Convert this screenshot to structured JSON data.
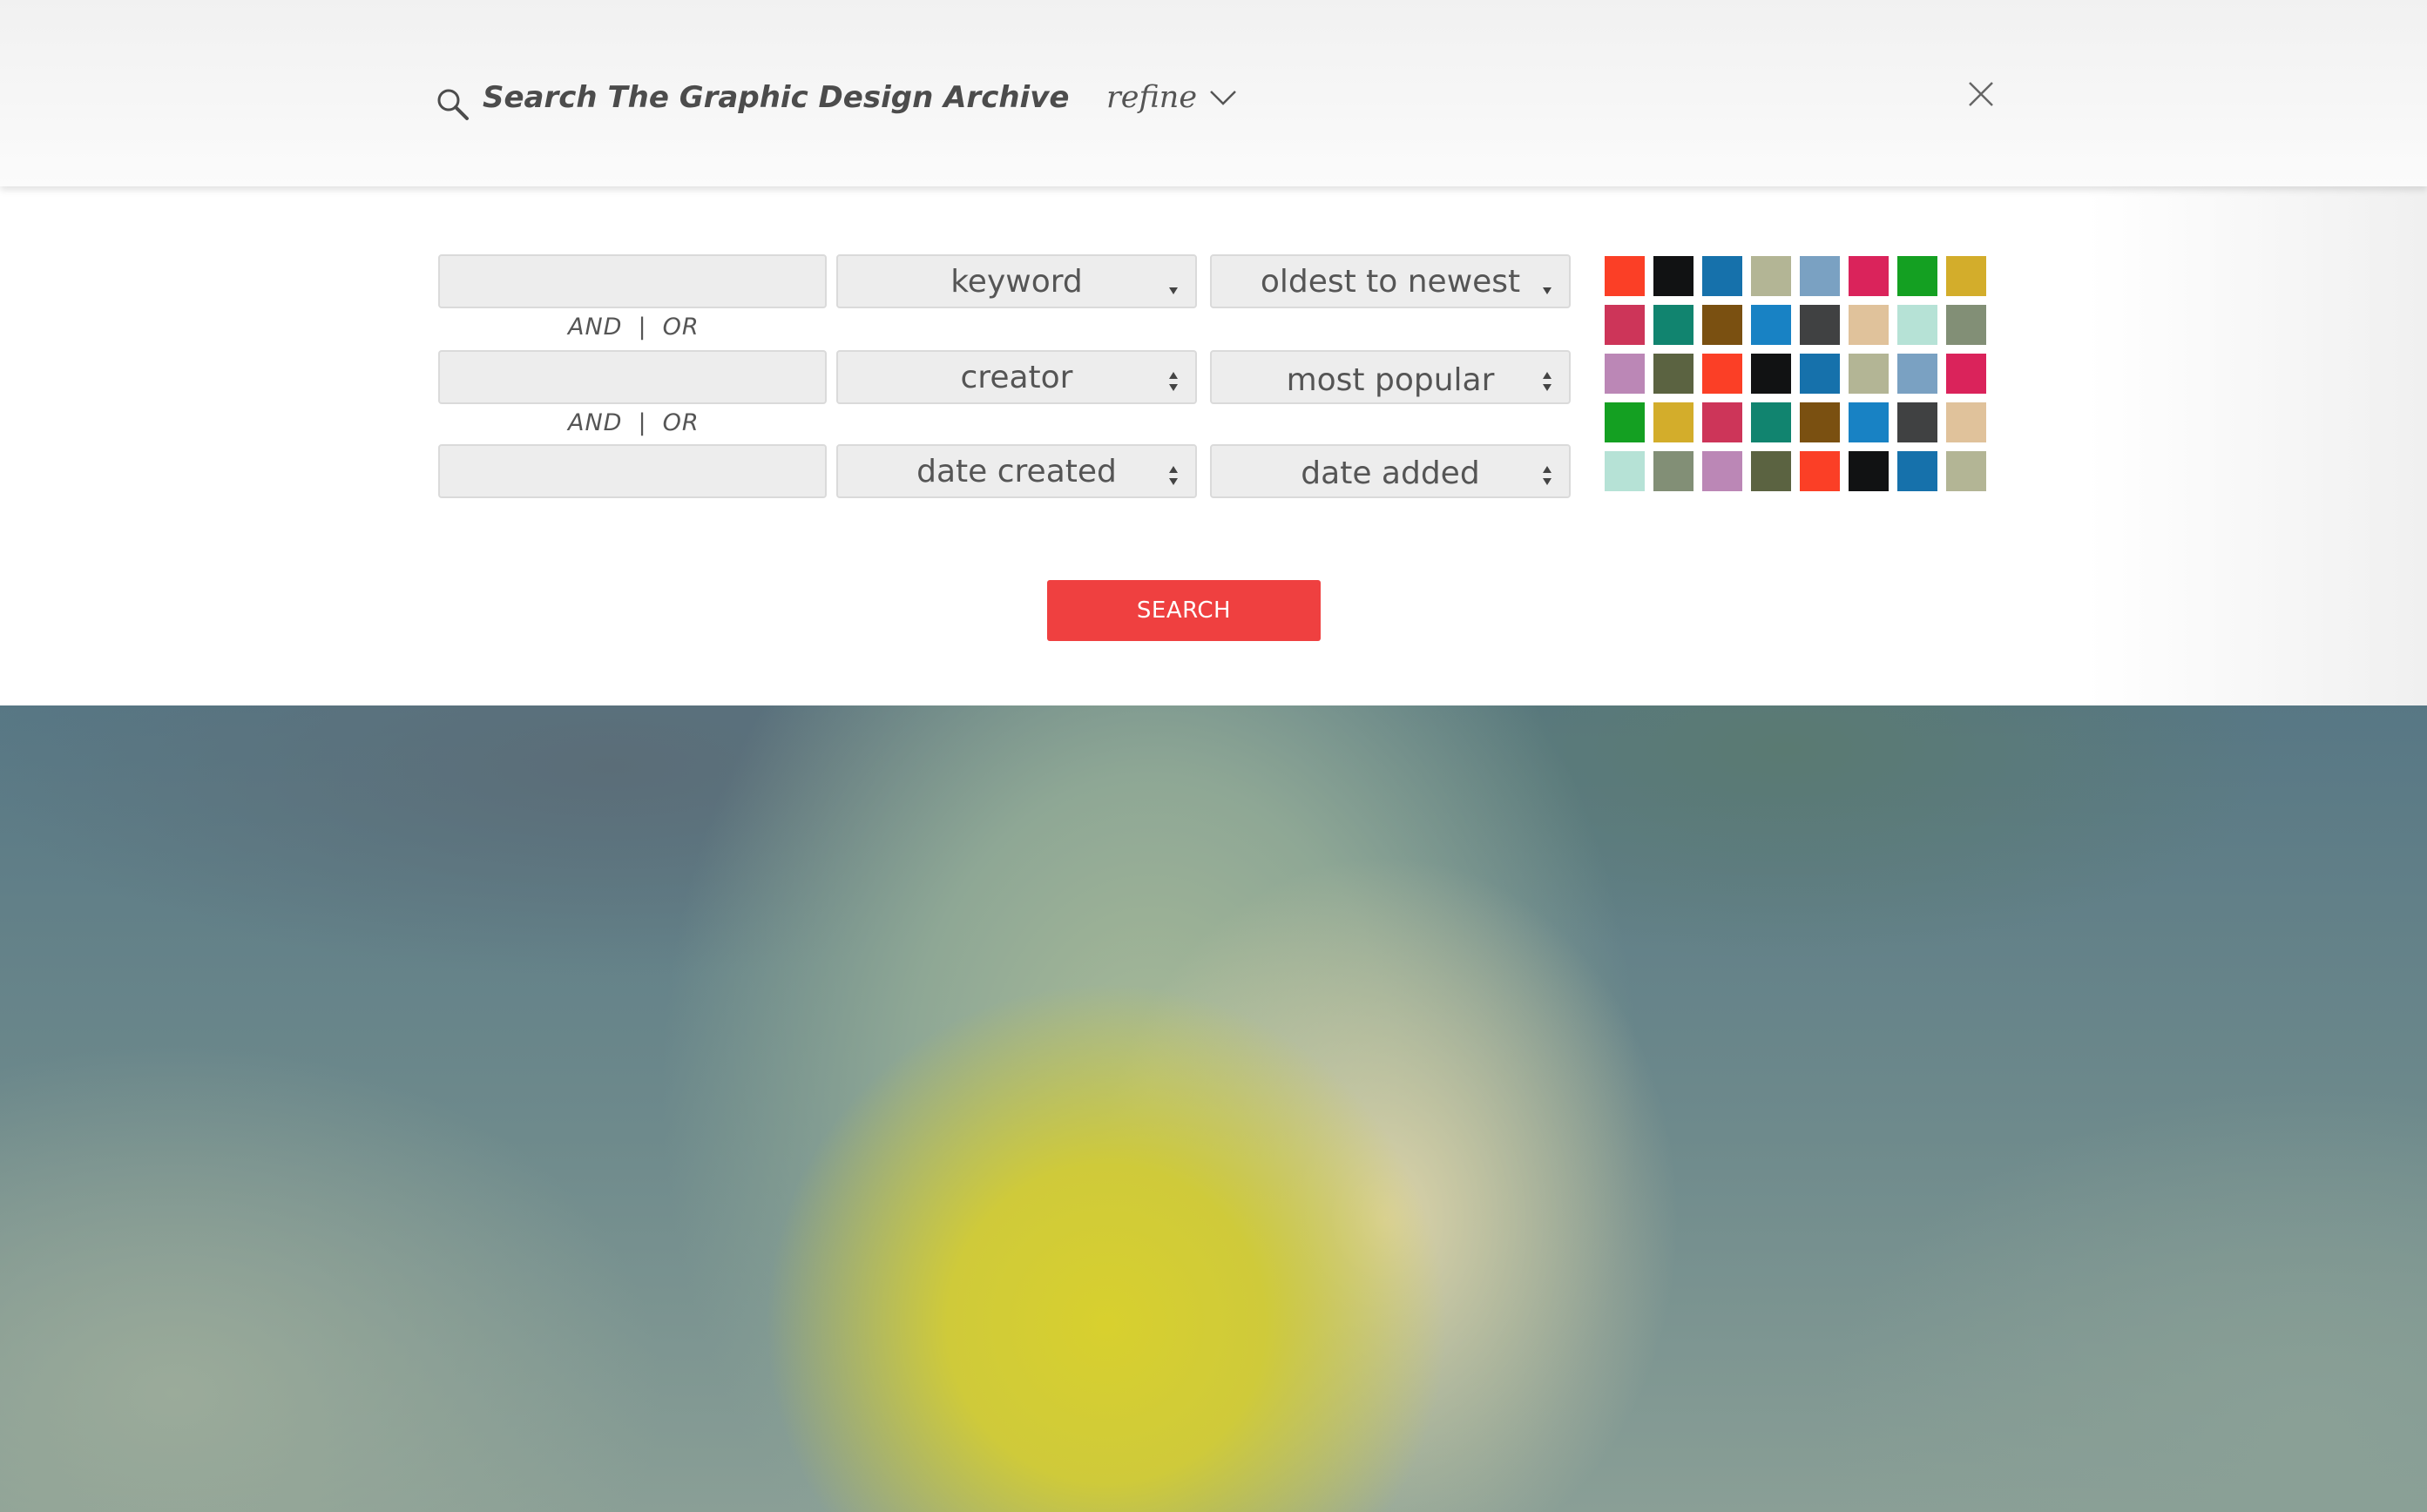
{
  "header": {
    "search_icon": "search-icon",
    "title": "Search The Graphic Design Archive",
    "refine_label": "refine",
    "refine_icon": "chevron-down-icon",
    "close_icon": "close-icon"
  },
  "refine": {
    "rows": [
      {
        "input_value": "",
        "field_select": "keyword",
        "sort_select": "oldest to newest"
      },
      {
        "input_value": "",
        "field_select": "creator",
        "sort_select": "most popular"
      },
      {
        "input_value": "",
        "field_select": "date created",
        "sort_select": "date added"
      }
    ],
    "connectors": [
      {
        "and": "AND",
        "sep": "|",
        "or": "OR"
      },
      {
        "and": "AND",
        "sep": "|",
        "or": "OR"
      }
    ],
    "color_swatches": [
      "#fb3f26",
      "#111213",
      "#1671ab",
      "#b3b595",
      "#7aa1c2",
      "#da235b",
      "#14a022",
      "#d3ad2b",
      "#cd3559",
      "#11846f",
      "#7a5011",
      "#1882c4",
      "#404142",
      "#e0c29b",
      "#b6e2d6",
      "#828f76",
      "#bb87b6",
      "#5b6341",
      "#fb3f26",
      "#111213",
      "#1671ab",
      "#b3b595",
      "#7aa1c2",
      "#da235b",
      "#14a022",
      "#d3ad2b",
      "#cd3559",
      "#11846f",
      "#7a5011",
      "#1882c4",
      "#404142",
      "#e0c29b",
      "#b6e2d6",
      "#828f76",
      "#bb87b6",
      "#5b6341",
      "#fb3f26",
      "#111213",
      "#1671ab",
      "#b3b595"
    ],
    "search_button": "SEARCH"
  },
  "colors": {
    "accent": "#ef4040",
    "panel_bg": "#ffffff",
    "field_bg": "#ededed"
  }
}
